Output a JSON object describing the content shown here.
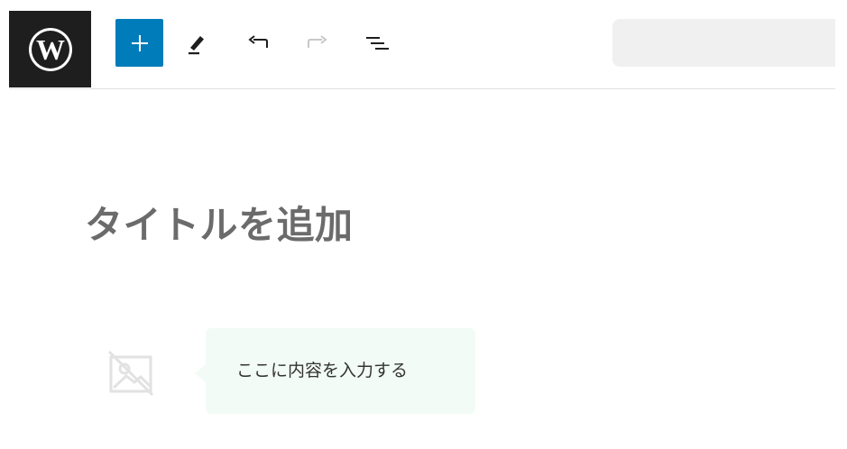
{
  "toolbar": {
    "logo_icon": "wordpress-logo-icon",
    "add_block_icon": "plus-icon",
    "tools_icon": "pencil-icon",
    "undo_icon": "undo-icon",
    "redo_icon": "redo-icon",
    "outline_icon": "list-view-icon",
    "colors": {
      "logo_bg": "#1e1e1e",
      "add_block_bg": "#007cba",
      "doc_bar_bg": "#f0f0f0"
    }
  },
  "editor": {
    "title_placeholder": "タイトルを追加",
    "image_placeholder_icon": "image-off-icon",
    "balloon": {
      "text": "ここに内容を入力する",
      "bg": "#f2fbf5"
    }
  }
}
